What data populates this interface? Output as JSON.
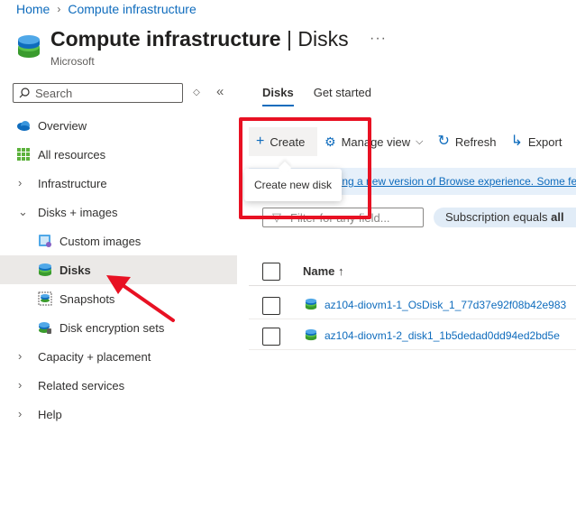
{
  "breadcrumb": {
    "home": "Home",
    "current": "Compute infrastructure"
  },
  "header": {
    "title": "Compute infrastructure",
    "title_suffix": "| Disks",
    "subtitle": "Microsoft",
    "more": "···"
  },
  "sidebar": {
    "search_placeholder": "Search",
    "items": [
      {
        "label": "Overview",
        "icon": "cloud-icon"
      },
      {
        "label": "All resources",
        "icon": "grid-icon"
      },
      {
        "label": "Infrastructure",
        "icon": "chevron-right-icon"
      },
      {
        "label": "Disks + images",
        "icon": "chevron-down-icon"
      },
      {
        "label": "Custom images",
        "icon": "custom-image-icon"
      },
      {
        "label": "Disks",
        "icon": "disk-icon"
      },
      {
        "label": "Snapshots",
        "icon": "snapshot-icon"
      },
      {
        "label": "Disk encryption sets",
        "icon": "encryption-set-icon"
      },
      {
        "label": "Capacity + placement",
        "icon": "chevron-right-icon"
      },
      {
        "label": "Related services",
        "icon": "chevron-right-icon"
      },
      {
        "label": "Help",
        "icon": "chevron-right-icon"
      }
    ]
  },
  "tabs": [
    {
      "label": "Disks"
    },
    {
      "label": "Get started"
    }
  ],
  "toolbar": {
    "create": "Create",
    "manage_view": "Manage view",
    "refresh": "Refresh",
    "export": "Export"
  },
  "tooltip": "Create new disk",
  "banner": {
    "text": "wing a new version of Browse experience. Some fe"
  },
  "filter": {
    "placeholder": "Filter for any field...",
    "pill_key": "Subscription",
    "pill_op": "equals",
    "pill_value": "all"
  },
  "grid": {
    "column_name": "Name ↑",
    "rows": [
      {
        "name": "az104-diovm1-1_OsDisk_1_77d37e92f08b42e983"
      },
      {
        "name": "az104-diovm1-2_disk1_1b5dedad0dd94ed2bd5e"
      }
    ]
  },
  "colors": {
    "accent": "#0f6cbd",
    "annotation": "#e81123",
    "active_bg": "#ebe9e7"
  }
}
